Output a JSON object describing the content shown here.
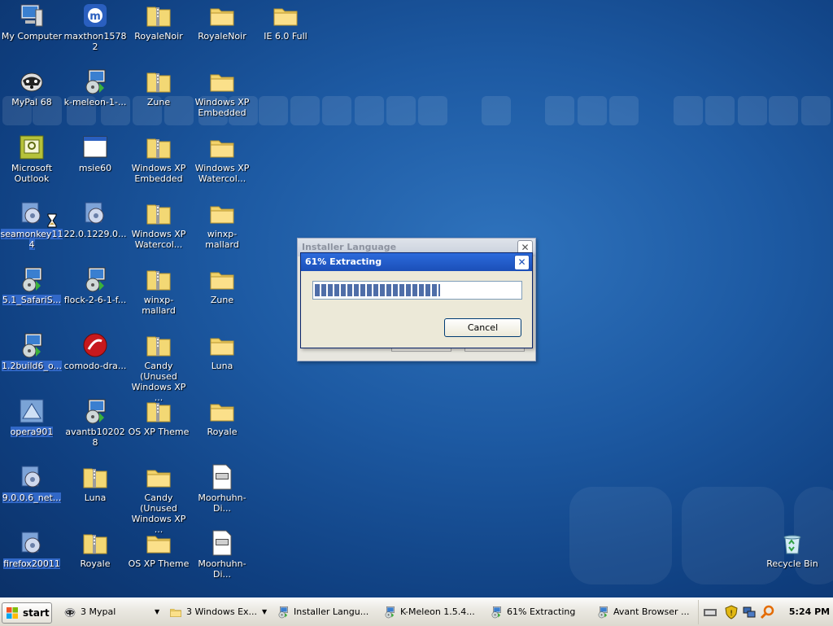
{
  "desktop_icons": [
    {
      "label": "My Computer",
      "icon": "computer-icon",
      "selected": false
    },
    {
      "label": "maxthon15782",
      "icon": "maxthon-icon",
      "selected": false
    },
    {
      "label": "RoyaleNoir",
      "icon": "zip-folder-icon",
      "selected": false
    },
    {
      "label": "RoyaleNoir",
      "icon": "folder-icon",
      "selected": false
    },
    {
      "label": "IE 6.0 Full",
      "icon": "folder-icon",
      "selected": false
    },
    {
      "label": "MyPal 68",
      "icon": "mypal-icon",
      "selected": false
    },
    {
      "label": "k-meleon-1-...",
      "icon": "installer-icon",
      "selected": false
    },
    {
      "label": "Zune",
      "icon": "zip-folder-icon",
      "selected": false
    },
    {
      "label": "Windows XP Embedded",
      "icon": "folder-icon",
      "selected": false
    },
    {
      "label": "Microsoft Outlook",
      "icon": "outlook-icon",
      "selected": false
    },
    {
      "label": "msie60",
      "icon": "window-icon",
      "selected": false
    },
    {
      "label": "Windows XP Embedded",
      "icon": "zip-folder-icon",
      "selected": false
    },
    {
      "label": "Windows XP Watercol...",
      "icon": "folder-icon",
      "selected": false
    },
    {
      "label": "seamonkey114",
      "icon": "setup-icon",
      "selected": true
    },
    {
      "label": "22.0.1229.0...",
      "icon": "setup-icon",
      "selected": false
    },
    {
      "label": "Windows XP Watercol...",
      "icon": "zip-folder-icon",
      "selected": false
    },
    {
      "label": "winxp-mallard",
      "icon": "folder-icon",
      "selected": false
    },
    {
      "label": "5.1_SafariS...",
      "icon": "installer-icon",
      "selected": true
    },
    {
      "label": "flock-2-6-1-f...",
      "icon": "installer-icon",
      "selected": false
    },
    {
      "label": "winxp-mallard",
      "icon": "zip-folder-icon",
      "selected": false
    },
    {
      "label": "Zune",
      "icon": "folder-icon",
      "selected": false
    },
    {
      "label": "1.2build6_o...",
      "icon": "installer-icon",
      "selected": true
    },
    {
      "label": "comodo-dra...",
      "icon": "comodo-icon",
      "selected": false
    },
    {
      "label": "Candy (Unused Windows XP ...",
      "icon": "zip-folder-icon",
      "selected": false
    },
    {
      "label": "Luna",
      "icon": "folder-icon",
      "selected": false
    },
    {
      "label": "opera901",
      "icon": "opera-setup-icon",
      "selected": true
    },
    {
      "label": "avantb102028",
      "icon": "installer-icon",
      "selected": false
    },
    {
      "label": "OS XP Theme",
      "icon": "zip-folder-icon",
      "selected": false
    },
    {
      "label": "Royale",
      "icon": "folder-icon",
      "selected": false
    },
    {
      "label": "9.0.0.6_net...",
      "icon": "setup-icon",
      "selected": true
    },
    {
      "label": "Luna",
      "icon": "zip-folder-icon",
      "selected": false
    },
    {
      "label": "Candy (Unused Windows XP ...",
      "icon": "folder-icon",
      "selected": false
    },
    {
      "label": "Moorhuhn-Di...",
      "icon": "document-icon",
      "selected": false
    },
    {
      "label": "firefox20011",
      "icon": "setup-icon",
      "selected": true
    },
    {
      "label": "Royale",
      "icon": "zip-folder-icon",
      "selected": false
    },
    {
      "label": "OS XP Theme",
      "icon": "folder-icon",
      "selected": false
    },
    {
      "label": "Moorhuhn-Di...",
      "icon": "document-icon",
      "selected": false
    },
    {
      "label": "Recycle Bin",
      "icon": "recycle-bin-icon",
      "selected": false
    }
  ],
  "dialog_back": {
    "title": "Installer Language"
  },
  "dialog_front": {
    "title": "61% Extracting",
    "progress": 0.61,
    "cancel_label": "Cancel"
  },
  "taskbar": {
    "start_label": "start",
    "tasks": [
      {
        "label": "3 Mypal",
        "icon": "mypal-icon",
        "group": true
      },
      {
        "label": "3 Windows Ex...",
        "icon": "folder-icon",
        "group": true
      },
      {
        "label": "Installer Langu...",
        "icon": "installer-icon",
        "group": false
      },
      {
        "label": "K-Meleon 1.5.4...",
        "icon": "installer-icon",
        "group": false
      },
      {
        "label": "61% Extracting",
        "icon": "installer-icon",
        "group": false
      },
      {
        "label": "Avant Browser ...",
        "icon": "installer-icon",
        "group": false
      }
    ],
    "clock": "5:24 PM"
  },
  "colors": {
    "desktop": "#1d5aa3",
    "selection": "#3168c8",
    "titlebar": "#1b4fb8"
  }
}
